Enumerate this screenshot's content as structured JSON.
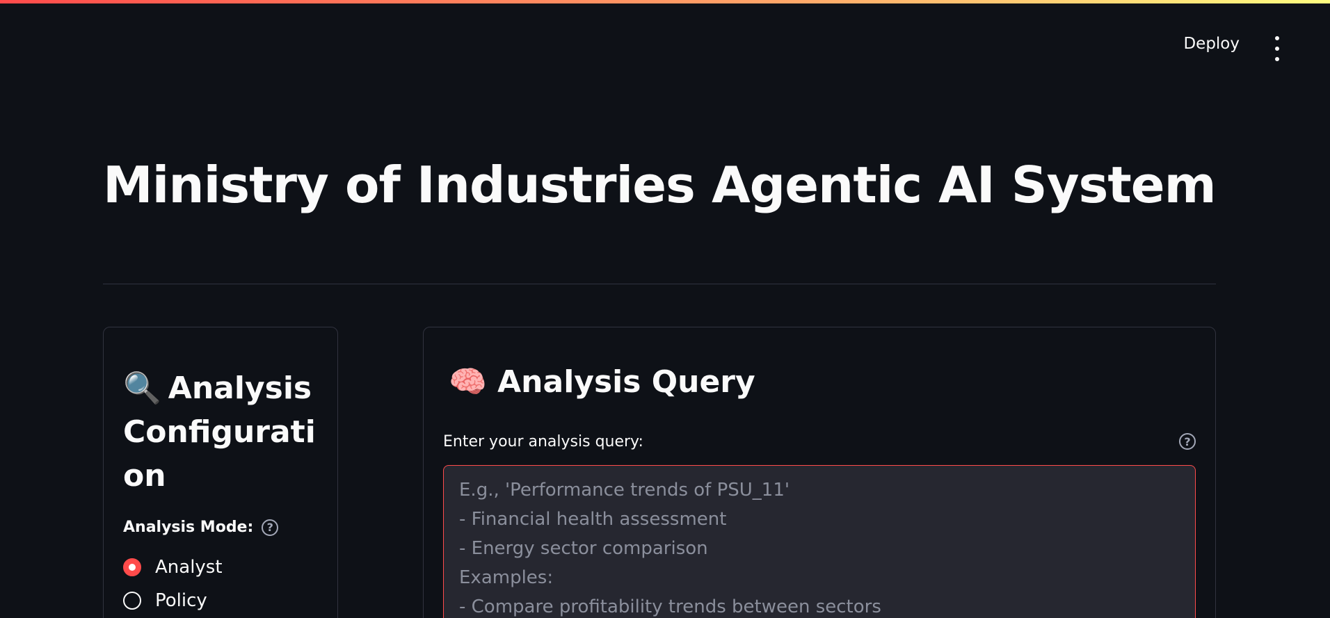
{
  "header": {
    "deploy_label": "Deploy",
    "menu_icon": "kebab-menu-icon"
  },
  "page": {
    "title": "Ministry of Industries Agentic AI System"
  },
  "config": {
    "icon": "🔍",
    "heading": "Analysis Configuration",
    "mode_label": "Analysis Mode:",
    "modes": [
      {
        "label": "Analyst",
        "selected": true
      },
      {
        "label": "Policy",
        "selected": false
      }
    ]
  },
  "query": {
    "icon": "🧠",
    "heading": "Analysis Query",
    "label": "Enter your analysis query:",
    "help_icon": "?",
    "placeholder": "E.g., 'Performance trends of PSU_11'\n- Financial health assessment\n- Energy sector comparison\nExamples:\n- Compare profitability trends between sectors"
  },
  "colors": {
    "background": "#0e1117",
    "accent": "#ff4b4b",
    "input_bg": "#262730",
    "border": "#31333f"
  }
}
